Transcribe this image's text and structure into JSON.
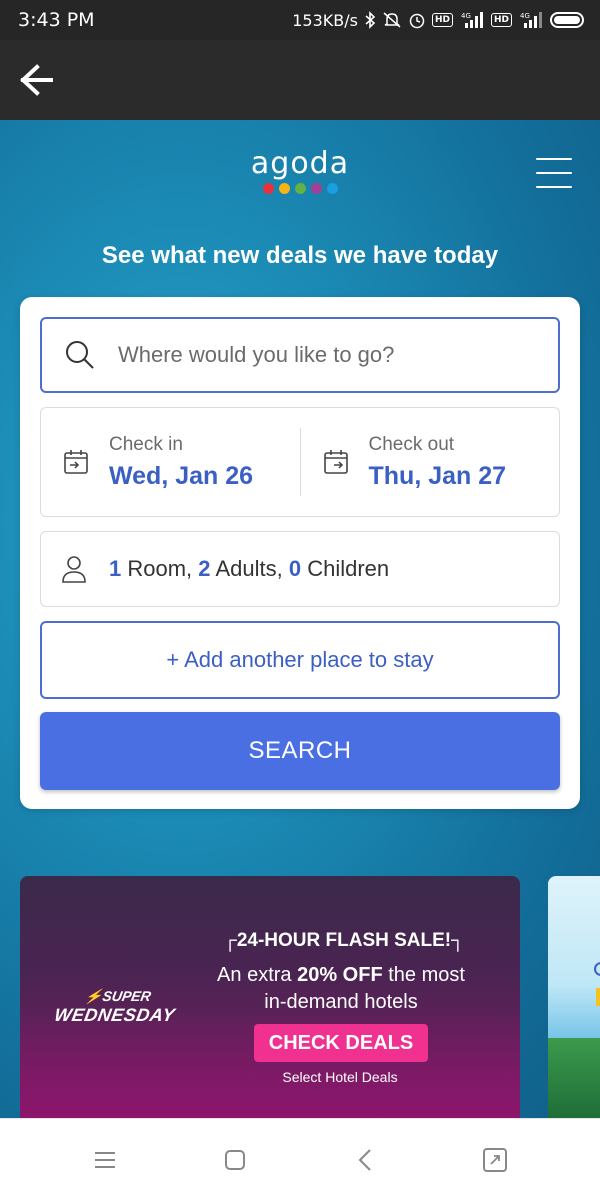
{
  "status_bar": {
    "time": "3:43 PM",
    "network_speed": "153KB/s",
    "icons": [
      "bluetooth-icon",
      "mute-icon",
      "alarm-icon",
      "hd-icon",
      "signal-4g-icon",
      "hd-icon",
      "signal-4g-icon",
      "battery-icon"
    ],
    "hd_label": "HD",
    "network_label": "4G"
  },
  "app_bar": {
    "back_icon": "arrow-left-icon"
  },
  "header": {
    "logo_text": "agoda",
    "logo_dot_colors": [
      "#e7323d",
      "#f7b416",
      "#62b245",
      "#a23f97",
      "#1a9fe0"
    ],
    "menu_icon": "hamburger-menu-icon",
    "tagline": "See what new deals we have today"
  },
  "search": {
    "placeholder": "Where would you like to go?",
    "check_in_label": "Check in",
    "check_in_value": "Wed, Jan 26",
    "check_out_label": "Check out",
    "check_out_value": "Thu, Jan 27",
    "rooms_count": "1",
    "rooms_label": "Room,",
    "adults_count": "2",
    "adults_label": "Adults,",
    "children_count": "0",
    "children_label": "Children",
    "add_place_label": "+ Add another place to stay",
    "search_button_label": "SEARCH"
  },
  "promo": {
    "badge_line1": "SUPER",
    "badge_line2": "WEDNESDAY",
    "headline": "24-HOUR FLASH SALE!",
    "line1_pre": "An extra ",
    "line1_bold": "20% OFF",
    "line1_post": " the most",
    "line2": "in-demand hotels",
    "cta": "CHECK DEALS",
    "subcta": "Select Hotel Deals"
  },
  "colors": {
    "accent": "#4a6fe3",
    "link_blue": "#3b5fc4",
    "promo_pink": "#f0318f"
  },
  "nav_bar": {
    "icons": [
      "menu-lines-icon",
      "home-square-icon",
      "back-chevron-icon",
      "recents-icon"
    ]
  }
}
